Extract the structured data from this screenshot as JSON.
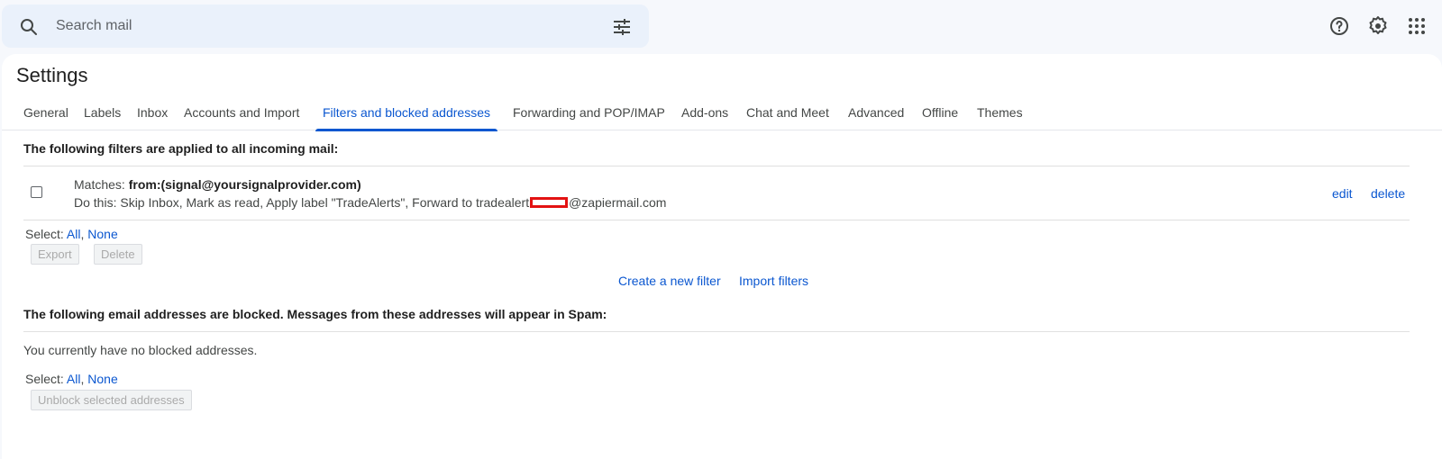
{
  "search": {
    "placeholder": "Search mail",
    "search_icon": "search-icon",
    "options_icon": "tune-icon"
  },
  "header_icons": [
    "help-icon",
    "settings-gear-icon",
    "apps-grid-icon"
  ],
  "page": {
    "title": "Settings"
  },
  "tabs": [
    {
      "label": "General",
      "active": false
    },
    {
      "label": "Labels",
      "active": false
    },
    {
      "label": "Inbox",
      "active": false
    },
    {
      "label": "Accounts and Import",
      "active": false
    },
    {
      "label": "Filters and blocked addresses",
      "active": true
    },
    {
      "label": "Forwarding and POP/IMAP",
      "active": false
    },
    {
      "label": "Add-ons",
      "active": false
    },
    {
      "label": "Chat and Meet",
      "active": false
    },
    {
      "label": "Advanced",
      "active": false
    },
    {
      "label": "Offline",
      "active": false
    },
    {
      "label": "Themes",
      "active": false
    }
  ],
  "filters_section": {
    "heading": "The following filters are applied to all incoming mail:",
    "filters": [
      {
        "matches_label": "Matches: ",
        "matches_value": "from:(signal@yoursignalprovider.com)",
        "action_prefix": "Do this: Skip Inbox, Mark as read, Apply label \"TradeAlerts\", Forward to tradealert",
        "action_suffix": "@zapiermail.com",
        "edit_label": "edit",
        "delete_label": "delete"
      }
    ],
    "select_label": "Select: ",
    "select_all": "All",
    "select_sep": ", ",
    "select_none": "None",
    "export_label": "Export",
    "delete_label": "Delete",
    "create_filter_label": "Create a new filter",
    "import_filters_label": "Import filters"
  },
  "blocked_section": {
    "heading": "The following email addresses are blocked. Messages from these addresses will appear in Spam:",
    "empty_message": "You currently have no blocked addresses.",
    "select_label": "Select: ",
    "select_all": "All",
    "select_sep": ", ",
    "select_none": "None",
    "unblock_label": "Unblock selected addresses"
  },
  "colors": {
    "accent": "#0b57d0",
    "background": "#f6f8fc",
    "search_bg": "#eaf1fb",
    "redaction": "#e31212"
  }
}
